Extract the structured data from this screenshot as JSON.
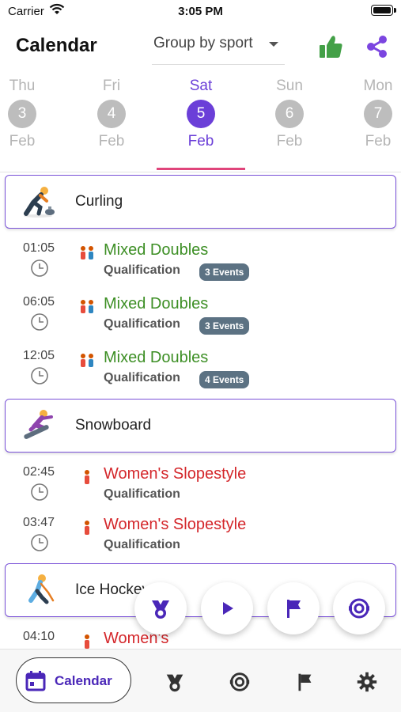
{
  "status_bar": {
    "carrier": "Carrier",
    "time": "3:05 PM"
  },
  "header": {
    "title": "Calendar",
    "group_select": {
      "value": "Group by sport"
    },
    "thumb_icon": "thumbs-up-icon",
    "share_icon": "share-icon"
  },
  "date_strip": {
    "days": [
      {
        "dow": "Thu",
        "day": "3",
        "month": "Feb",
        "selected": false
      },
      {
        "dow": "Fri",
        "day": "4",
        "month": "Feb",
        "selected": false
      },
      {
        "dow": "Sat",
        "day": "5",
        "month": "Feb",
        "selected": true
      },
      {
        "dow": "Sun",
        "day": "6",
        "month": "Feb",
        "selected": false
      },
      {
        "dow": "Mon",
        "day": "7",
        "month": "Feb",
        "selected": false
      }
    ]
  },
  "sports": [
    {
      "name": "Curling",
      "icon": "curling-icon",
      "events": [
        {
          "time": "01:05",
          "name": "Mixed Doubles",
          "phase": "Qualification",
          "badge": "3 Events",
          "color": "green"
        },
        {
          "time": "06:05",
          "name": "Mixed Doubles",
          "phase": "Qualification",
          "badge": "3 Events",
          "color": "green"
        },
        {
          "time": "12:05",
          "name": "Mixed Doubles",
          "phase": "Qualification",
          "badge": "4 Events",
          "color": "green"
        }
      ]
    },
    {
      "name": "Snowboard",
      "icon": "snowboard-icon",
      "events": [
        {
          "time": "02:45",
          "name": "Women's Slopestyle",
          "phase": "Qualification",
          "badge": "",
          "color": "red"
        },
        {
          "time": "03:47",
          "name": "Women's Slopestyle",
          "phase": "Qualification",
          "badge": "",
          "color": "red"
        }
      ]
    },
    {
      "name": "Ice Hockey",
      "icon": "ice-hockey-icon",
      "events": [
        {
          "time": "04:10",
          "name": "Women's",
          "phase": "",
          "badge": "",
          "color": "red"
        }
      ]
    }
  ],
  "fabs": [
    "medals-icon",
    "play-icon",
    "flag-icon",
    "olympic-rings-icon"
  ],
  "bottom_nav": {
    "calendar_label": "Calendar",
    "items": [
      "medals-icon",
      "olympic-rings-icon",
      "flag-icon",
      "gear-icon"
    ]
  },
  "colors": {
    "accent": "#6b3fd8",
    "underline": "#e0457b",
    "green_event": "#3d8f25",
    "red_event": "#d4272b",
    "badge": "#5c7283"
  }
}
